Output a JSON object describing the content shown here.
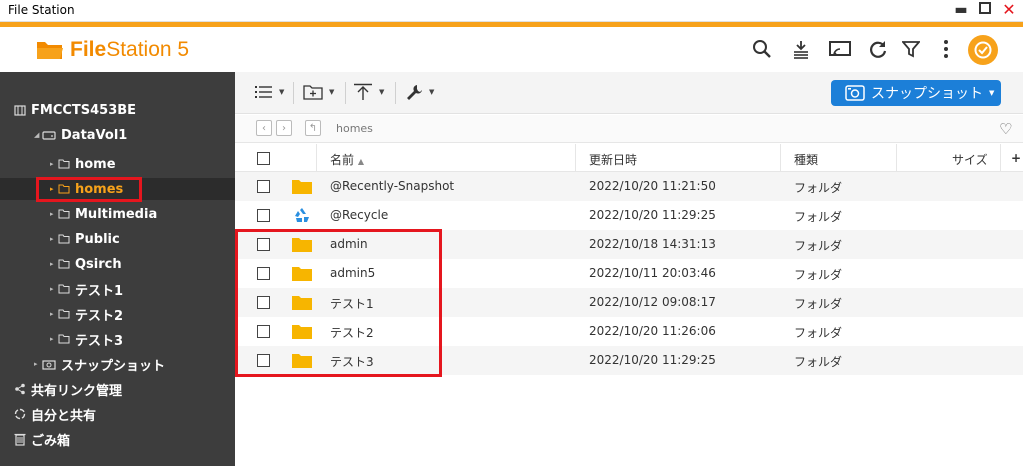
{
  "window": {
    "title": "File Station"
  },
  "app": {
    "name": "FileStation 5",
    "name_bold": "File",
    "name_rest": "Station 5"
  },
  "colors": {
    "accent": "#f7a21b",
    "brand_text": "#f28a00",
    "sidebar_bg": "#3d3d3d",
    "primary_button": "#1c7fd8",
    "highlight_box": "#e5161e",
    "folder": "#f7b500"
  },
  "header_icons": [
    "search-icon",
    "background-tasks-icon",
    "remote-mount-icon",
    "refresh-icon",
    "filter-icon",
    "more-icon",
    "user-avatar-icon"
  ],
  "sidebar": {
    "nas": "FMCCTS453BE",
    "volume": "DataVol1",
    "folders": [
      {
        "label": "home",
        "selected": false
      },
      {
        "label": "homes",
        "selected": true
      },
      {
        "label": "Multimedia",
        "selected": false
      },
      {
        "label": "Public",
        "selected": false
      },
      {
        "label": "Qsirch",
        "selected": false
      },
      {
        "label": "テスト1",
        "selected": false
      },
      {
        "label": "テスト2",
        "selected": false
      },
      {
        "label": "テスト3",
        "selected": false
      }
    ],
    "snapshot": "スナップショット",
    "shared_links": "共有リンク管理",
    "shared_with_me": "自分と共有",
    "recycle_bin": "ごみ箱"
  },
  "toolbar": {
    "view_icon": "list-view-icon",
    "new_folder_icon": "new-folder-icon",
    "upload_icon": "upload-icon",
    "tools_icon": "wrench-icon",
    "snapshot_button": "スナップショット"
  },
  "nav": {
    "path": "homes"
  },
  "table": {
    "headers": {
      "name": "名前",
      "modified": "更新日時",
      "type": "種類",
      "size": "サイズ"
    },
    "rows": [
      {
        "name": "@Recently-Snapshot",
        "modified": "2022/10/20 11:21:50",
        "type": "フォルダ",
        "icon": "folder-icon"
      },
      {
        "name": "@Recycle",
        "modified": "2022/10/20 11:29:25",
        "type": "フォルダ",
        "icon": "recycle-icon"
      },
      {
        "name": "admin",
        "modified": "2022/10/18 14:31:13",
        "type": "フォルダ",
        "icon": "folder-icon"
      },
      {
        "name": "admin5",
        "modified": "2022/10/11 20:03:46",
        "type": "フォルダ",
        "icon": "folder-icon"
      },
      {
        "name": "テスト1",
        "modified": "2022/10/12 09:08:17",
        "type": "フォルダ",
        "icon": "folder-icon"
      },
      {
        "name": "テスト2",
        "modified": "2022/10/20 11:26:06",
        "type": "フォルダ",
        "icon": "folder-icon"
      },
      {
        "name": "テスト3",
        "modified": "2022/10/20 11:29:25",
        "type": "フォルダ",
        "icon": "folder-icon"
      }
    ]
  }
}
